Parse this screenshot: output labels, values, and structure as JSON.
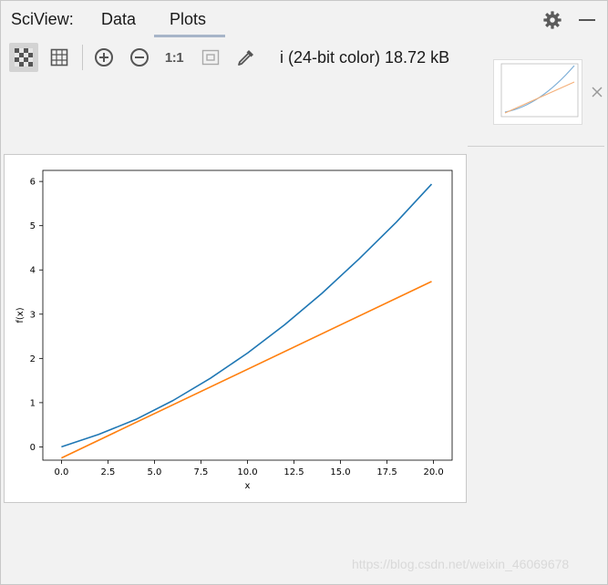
{
  "header": {
    "app_label": "SciView:",
    "tabs": [
      {
        "label": "Data",
        "active": false
      },
      {
        "label": "Plots",
        "active": true
      }
    ]
  },
  "toolbar": {
    "buttons": [
      "checkerboard-toggle",
      "grid-toggle",
      "zoom-in",
      "zoom-out",
      "actual-size",
      "fit-to-window",
      "color-picker"
    ],
    "actual_size_label": "1:1",
    "image_info": "i (24-bit color) 18.72 kB"
  },
  "watermark": "https://blog.csdn.net/weixin_46069678",
  "colors": {
    "series1": "#1f77b4",
    "series2": "#ff7f0e",
    "accent_underline": "#a7b5c8"
  },
  "chart_data": {
    "type": "line",
    "title": "",
    "xlabel": "x",
    "ylabel": "f(x)",
    "xlim": [
      -1,
      21
    ],
    "ylim": [
      -0.3,
      6.25
    ],
    "xticks": [
      0.0,
      2.5,
      5.0,
      7.5,
      10.0,
      12.5,
      15.0,
      17.5,
      20.0
    ],
    "xtick_labels": [
      "0.0",
      "2.5",
      "5.0",
      "7.5",
      "10.0",
      "12.5",
      "15.0",
      "17.5",
      "20.0"
    ],
    "yticks": [
      0,
      1,
      2,
      3,
      4,
      5,
      6
    ],
    "ytick_labels": [
      "0",
      "1",
      "2",
      "3",
      "4",
      "5",
      "6"
    ],
    "grid": false,
    "series": [
      {
        "color": "#1f77b4",
        "x": [
          0,
          2,
          4,
          6,
          8,
          10,
          12,
          14,
          16,
          18,
          19.9
        ],
        "y": [
          0.0,
          0.28,
          0.62,
          1.05,
          1.55,
          2.12,
          2.76,
          3.47,
          4.25,
          5.08,
          5.94
        ]
      },
      {
        "color": "#ff7f0e",
        "x": [
          0,
          19.9
        ],
        "y": [
          -0.25,
          3.74
        ]
      }
    ]
  }
}
